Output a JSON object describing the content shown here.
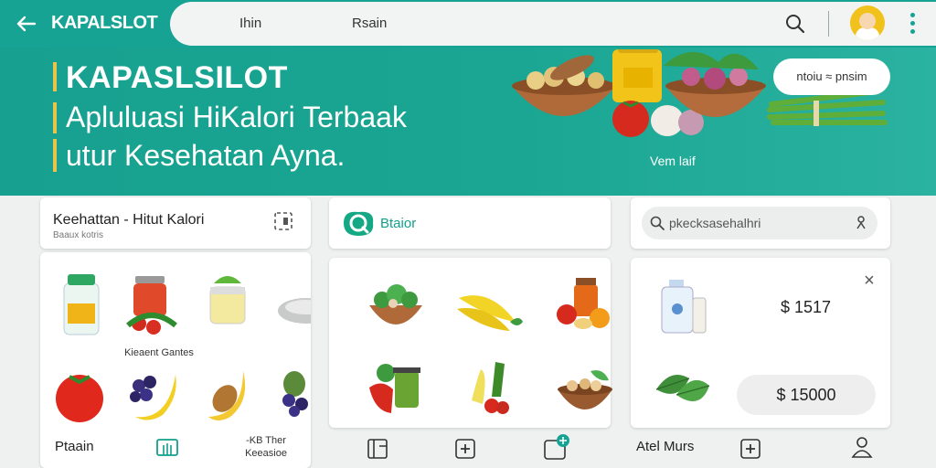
{
  "app": {
    "brand": "KAPALSLOT"
  },
  "topbar": {
    "search_tab1": "Ihin",
    "search_tab2": "Rsain"
  },
  "hero": {
    "title": "KAPASLSILOT",
    "subtitle_line1": "Apluluasi HiKalori Terbaak",
    "subtitle_line2": "utur Kesehatan Ayna.",
    "pill_text": "ntoiu ≈ pnsim",
    "caption": "Vem laif"
  },
  "card_health": {
    "title": "Keehattan - Hitut Kalori",
    "subtitle": "Baaux kotris"
  },
  "card_brand": {
    "label": "Btaior"
  },
  "card_search": {
    "placeholder": "pkecksasehalhri"
  },
  "products_left": {
    "caption_row1": "Kieaent Gantes",
    "caption_row2_line1": "-KB Ther",
    "caption_row2_line2": "Keeasioe"
  },
  "detail_card": {
    "price_top": "$ 1517",
    "price_button": "$ 15000"
  },
  "bottom": {
    "left_label": "Ptaain",
    "right_label": "Atel Murs"
  },
  "colors": {
    "primary": "#16a394",
    "accent": "#e9c34a"
  },
  "icons": [
    "back-arrow-icon",
    "search-icon",
    "more-vert-icon",
    "layout-icon",
    "plus-icon",
    "gallery-icon",
    "person-icon",
    "close-icon",
    "mic-icon"
  ]
}
